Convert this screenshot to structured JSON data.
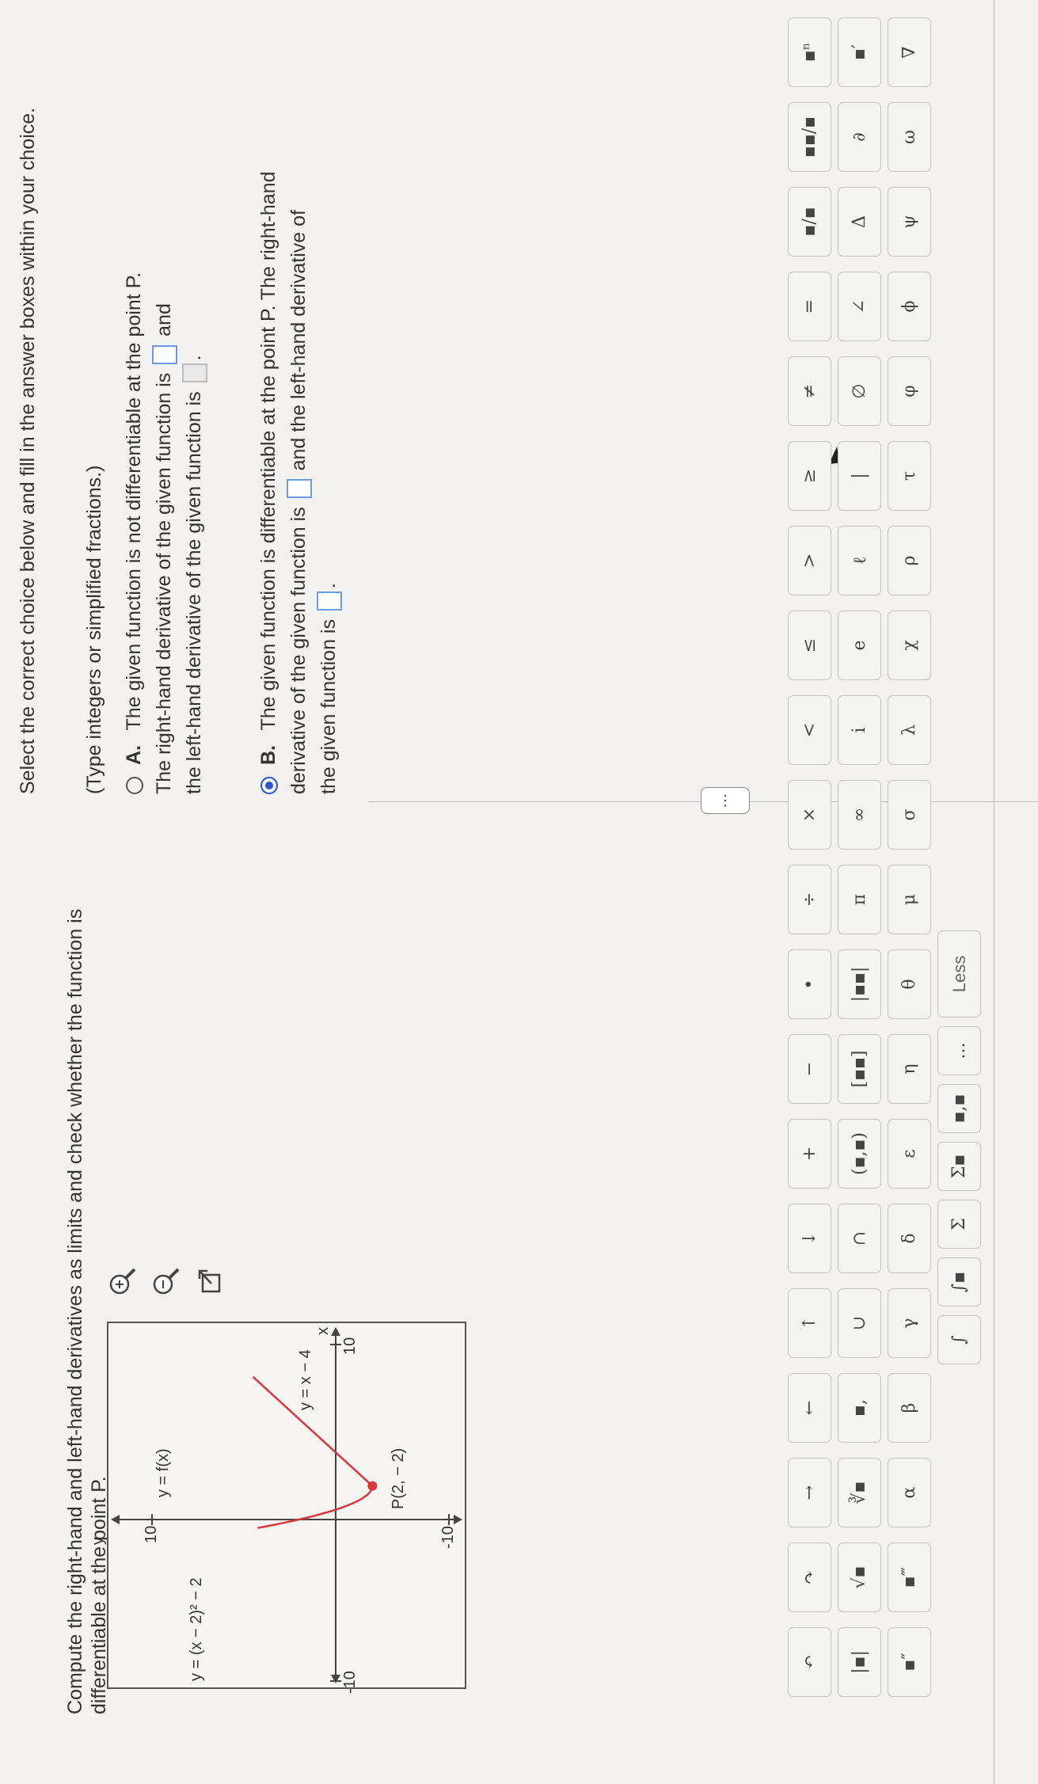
{
  "question": "Compute the right-hand and left-hand derivatives as limits and check whether the function is differentiable at the point P.",
  "graph": {
    "ylabel": "y",
    "xlabel": "x",
    "y_top": "10",
    "y_bottom": "-10",
    "x_left": "-10",
    "x_right": "10",
    "curve_label_f": "y = f(x)",
    "curve_label_left": "y = (x − 2)² − 2",
    "curve_label_right": "y = x − 4",
    "point_label": "P(2, − 2)"
  },
  "tools": [
    "zoom-in-icon",
    "zoom-out-icon",
    "external-link-icon"
  ],
  "more_button": "⋮",
  "instructions": "Select the correct choice below and fill in the answer boxes within your choice.",
  "hint": "(Type integers or simplified fractions.)",
  "choice_a": {
    "letter": "A.",
    "line1": "The given function is not differentiable at the point P.",
    "line2a": "The right-hand derivative of the given function is",
    "line2b": "and",
    "line3": "the left-hand derivative of the given function is",
    "line3_end": "."
  },
  "choice_b": {
    "letter": "B.",
    "line1": "The given function is differentiable at the point P. The right-hand",
    "line2a": "derivative of the given function is",
    "line2b": "and the left-hand derivative of",
    "line3": "the given function is",
    "line3_end": "."
  },
  "selected_choice": "B",
  "palette": {
    "rows": [
      [
        "↶",
        "↷",
        "→",
        "←",
        "↑",
        "↓",
        "+",
        "−",
        "•",
        "÷",
        "×",
        "<",
        "≤",
        ">",
        "≥",
        "≠",
        "=",
        "▪/▪",
        "▪▪/▪",
        "▪ⁿ"
      ],
      [
        "|▪|",
        "√▪",
        "∛▪",
        "▪,",
        "∪",
        "∩",
        "(▪,▪)",
        "[▪▪]",
        "|▪▪|",
        "π",
        "∞",
        "i",
        "e",
        "ℓ",
        "|",
        "∅",
        "∠",
        "Δ",
        "∂",
        "▪′"
      ],
      [
        "▪″",
        "▪‴",
        "α",
        "β",
        "γ",
        "δ",
        "ε",
        "η",
        "θ",
        "μ",
        "σ",
        "λ",
        "χ",
        "ρ",
        "τ",
        "φ",
        "ϕ",
        "ψ",
        "ω",
        "∇"
      ],
      [
        "∫",
        "∫▪",
        "Σ",
        "Σ▪",
        "▪,▪",
        "...",
        "Less"
      ]
    ]
  },
  "colors": {
    "accent": "#2a56c6",
    "curve": "#d9363e",
    "box_border": "#6c9be0"
  }
}
